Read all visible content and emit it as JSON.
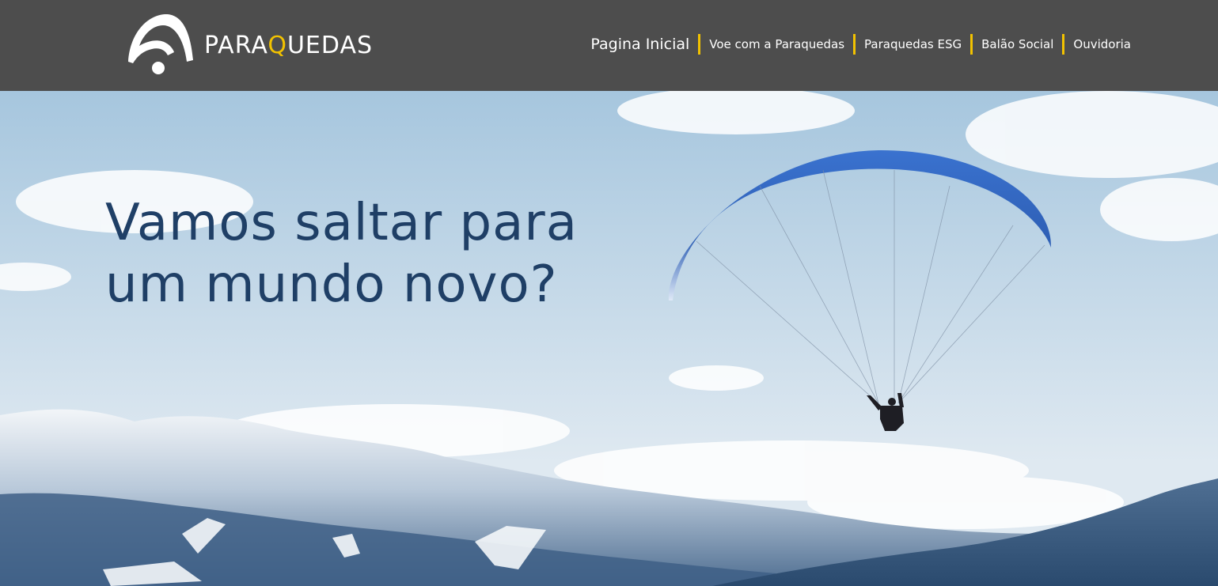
{
  "brand": {
    "name_prefix": "PARA",
    "name_accent": "Q",
    "name_suffix": "UEDAS",
    "logo_icon": "paraglider-logo-icon",
    "accent_color": "#f2c200",
    "text_color": "#ffffff"
  },
  "nav": {
    "separator_color": "#f2c200",
    "items": [
      {
        "label": "Pagina Inicial"
      },
      {
        "label": "Voe com a Paraquedas"
      },
      {
        "label": "Paraquedas ESG"
      },
      {
        "label": "Balão Social"
      },
      {
        "label": "Ouvidoria"
      }
    ]
  },
  "hero": {
    "title_line1": "Vamos saltar para",
    "title_line2": "um mundo novo?",
    "title_color": "#1f3f66",
    "image": "paraglider-over-snowy-mountains"
  },
  "colors": {
    "header_bg": "#4d4d4d",
    "sky_top": "#a6c6de",
    "sky_bottom": "#dfe9f1",
    "canopy": "#2e5fb5"
  }
}
